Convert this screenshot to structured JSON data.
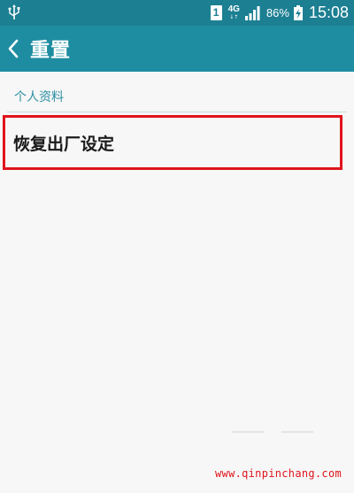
{
  "status_bar": {
    "usb_icon": "usb-icon",
    "sim_label": "1",
    "network_type": "4G",
    "network_arrows": "↓↑",
    "battery_percent": "86%",
    "time": "15:08",
    "background": "#1c7f92"
  },
  "action_bar": {
    "back_icon": "chevron-left-icon",
    "title": "重置",
    "background": "#1f8da1"
  },
  "section": {
    "header": "个人资料"
  },
  "items": [
    {
      "label": "恢复出厂设定",
      "highlight_color": "#e0141c"
    }
  ],
  "watermark": "www.qinpinchang.com"
}
